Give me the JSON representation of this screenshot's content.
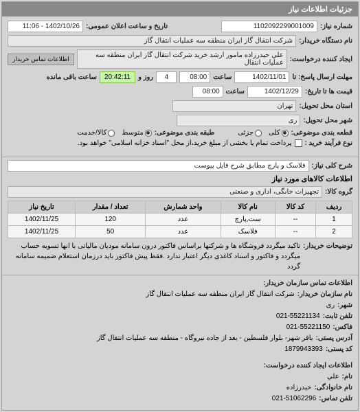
{
  "panel_title": "جزئیات اطلاعات نیاز",
  "request_no": {
    "label": "شماره نیاز:",
    "value": "1102092299001009"
  },
  "announce": {
    "label": "تاریخ و ساعت اعلان عمومی:",
    "value": "1402/10/26 - 11:06"
  },
  "buyer_org": {
    "label": "نام دستگاه خریدار:",
    "value": "شرکت انتقال گاز ایران منطقه سه عملیات انتقال گاز"
  },
  "requester": {
    "label": "ایجاد کننده درخواست:",
    "value": "علي حيدرزاده مامور ارشد خريد شركت انتقال گاز ايران منطقه سه عمليات انتقال"
  },
  "contact_btn": "اطلاعات تماس خریدار",
  "deadline": {
    "label1": "مهلت ارسال پاسخ: تا",
    "date": "1402/11/01",
    "time_label": "ساعت",
    "time": "08:00",
    "remain_days": "4",
    "remain_days_label": "روز و",
    "remain_time": "20:42:11",
    "remain_suffix": "ساعت باقی مانده"
  },
  "quote_until": {
    "label": "قیمت ها تا تاریخ:",
    "date": "1402/12/29",
    "time_label": "ساعت",
    "time": "08:00"
  },
  "province": {
    "label": "استان محل تحویل:",
    "value": "تهران"
  },
  "city": {
    "label": "شهر محل تحویل:",
    "value": "ری"
  },
  "partial": {
    "label": "قطعه بندی موضوعی:",
    "options": {
      "all": "کلی",
      "partial": "جزئی"
    }
  },
  "budget": {
    "label": "طبقه بندی موضوعی:",
    "options": {
      "mid": "متوسط",
      "goods": "کالا/خدمت"
    }
  },
  "process": {
    "label": "نوع فرآیند خرید :",
    "text": "پرداخت تمام یا بخشی از مبلغ خرید،از محل \"اسناد خزانه اسلامی\" خواهد بود."
  },
  "need_title": {
    "label": "شرح کلی نیاز:",
    "value": "فلاسک و پارچ مطابق شرح فایل پیوست"
  },
  "items_section": "اطلاعات کالاهای مورد نیاز",
  "group": {
    "label": "گروه کالا:",
    "value": "تجهیزات خانگی، اداری و صنعتی"
  },
  "table": {
    "headers": [
      "ردیف",
      "کد کالا",
      "نام کالا",
      "واحد شمارش",
      "تعداد / مقدار",
      "تاریخ نیاز"
    ],
    "rows": [
      {
        "idx": "1",
        "code": "--",
        "name": "ست,پارچ",
        "unit": "عدد",
        "qty": "120",
        "date": "1402/11/25"
      },
      {
        "idx": "2",
        "code": "--",
        "name": "فلاسک",
        "unit": "عدد",
        "qty": "50",
        "date": "1402/11/25"
      }
    ]
  },
  "buyer_note": {
    "label": "توضیحات خریدار:",
    "text": "تاکید میگردد فروشگاه ها و شرکتها براساس فاکتور درون سامانه مودیان مالیاتی با انها تسویه حساب میگردد و فاکتور و اسناد کاغذی دیگر اعتبار ندارد .فقط پیش فاکتور باید درزمان استعلام ضمیمه سامانه گردد"
  },
  "contact_section": "اطلاعات تماس سازمان خریدار:",
  "contact": {
    "org_label": "نام سازمان خریدار:",
    "org": "شرکت انتقال گاز ایران منطقه سه عملیات انتقال گاز",
    "city_label": "شهر:",
    "city": "ری",
    "phone_label": "تلفن ثابت:",
    "phone": "021-55221134",
    "fax_label": "فاکس:",
    "fax": "021-55221150",
    "addr_label": "آدرس پستی:",
    "addr": "باقر شهر- بلوار فلسطین - بعد از جاده نیروگاه - منطقه سه عملیات انتقال گاز",
    "post_label": "کد پستی:",
    "post": "1879943393"
  },
  "creator_section": "اطلاعات ایجاد کننده درخواست:",
  "creator": {
    "fname_label": "نام:",
    "fname": "علي",
    "lname_label": "نام خانوادگی:",
    "lname": "حيدرزاده",
    "phone_label": "تلفن تماس:",
    "phone": "021-51062296"
  }
}
